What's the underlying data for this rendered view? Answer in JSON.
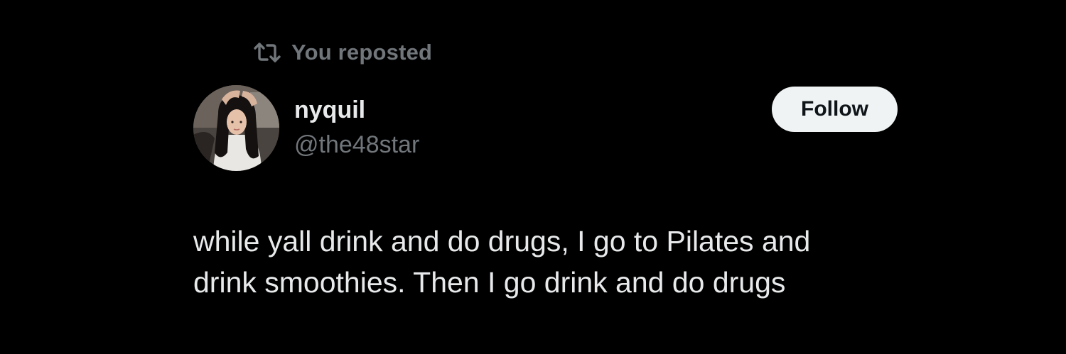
{
  "repost": {
    "label": "You reposted",
    "icon": "repost-icon"
  },
  "author": {
    "display_name": "nyquil",
    "handle": "@the48star",
    "avatar": "avatar-photo"
  },
  "follow_button": {
    "label": "Follow"
  },
  "tweet": {
    "line_1": "while yall drink and do drugs, I go to Pilates and",
    "line_2": "drink smoothies. Then I go drink and do drugs"
  },
  "colors": {
    "background": "#000000",
    "primary_text": "#e7e9ea",
    "secondary_text": "#71767b",
    "button_bg": "#eff3f4",
    "button_text": "#0f1419"
  }
}
